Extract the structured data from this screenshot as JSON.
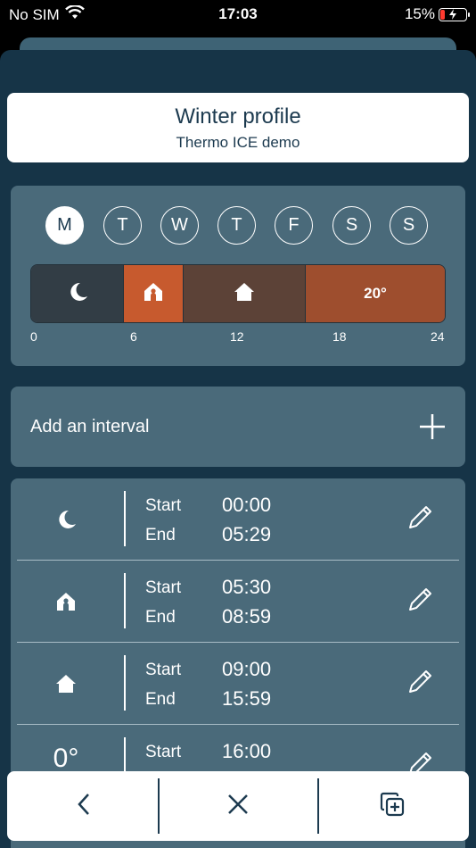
{
  "status_bar": {
    "carrier": "No SIM",
    "time": "17:03",
    "battery": "15%"
  },
  "profile": {
    "title": "Winter profile",
    "subtitle": "Thermo ICE demo"
  },
  "days": [
    {
      "label": "M",
      "active": true
    },
    {
      "label": "T",
      "active": false
    },
    {
      "label": "W",
      "active": false
    },
    {
      "label": "T",
      "active": false
    },
    {
      "label": "F",
      "active": false
    },
    {
      "label": "S",
      "active": false
    },
    {
      "label": "S",
      "active": false
    }
  ],
  "timeline": {
    "segments": [
      {
        "icon": "moon-icon",
        "start": "00:00",
        "end": "05:29"
      },
      {
        "icon": "away-home-icon",
        "start": "05:30",
        "end": "08:59"
      },
      {
        "icon": "home-icon",
        "start": "09:00",
        "end": "15:59"
      },
      {
        "label": "20°",
        "start": "16:00",
        "end": "24:00"
      }
    ],
    "ticks": [
      "0",
      "6",
      "12",
      "18",
      "24"
    ]
  },
  "add_interval": {
    "label": "Add an interval"
  },
  "intervals": [
    {
      "icon": "moon-icon",
      "start_label": "Start",
      "end_label": "End",
      "start": "00:00",
      "end": "05:29"
    },
    {
      "icon": "away-home-icon",
      "start_label": "Start",
      "end_label": "End",
      "start": "05:30",
      "end": "08:59"
    },
    {
      "icon": "home-icon",
      "start_label": "Start",
      "end_label": "End",
      "start": "09:00",
      "end": "15:59"
    },
    {
      "icon_text": "0°",
      "start_label": "Start",
      "end_label": "End",
      "start": "16:00",
      "end": ""
    }
  ],
  "colors": {
    "background": "#163447",
    "card": "#4a6a7a",
    "night": "#323d45",
    "away": "#c75a2e",
    "home": "#5c4237",
    "comfort": "#9e4e2e"
  },
  "bottom_bar": {
    "back_icon": "chevron-left-icon",
    "close_icon": "close-icon",
    "copy_icon": "copy-icon"
  }
}
